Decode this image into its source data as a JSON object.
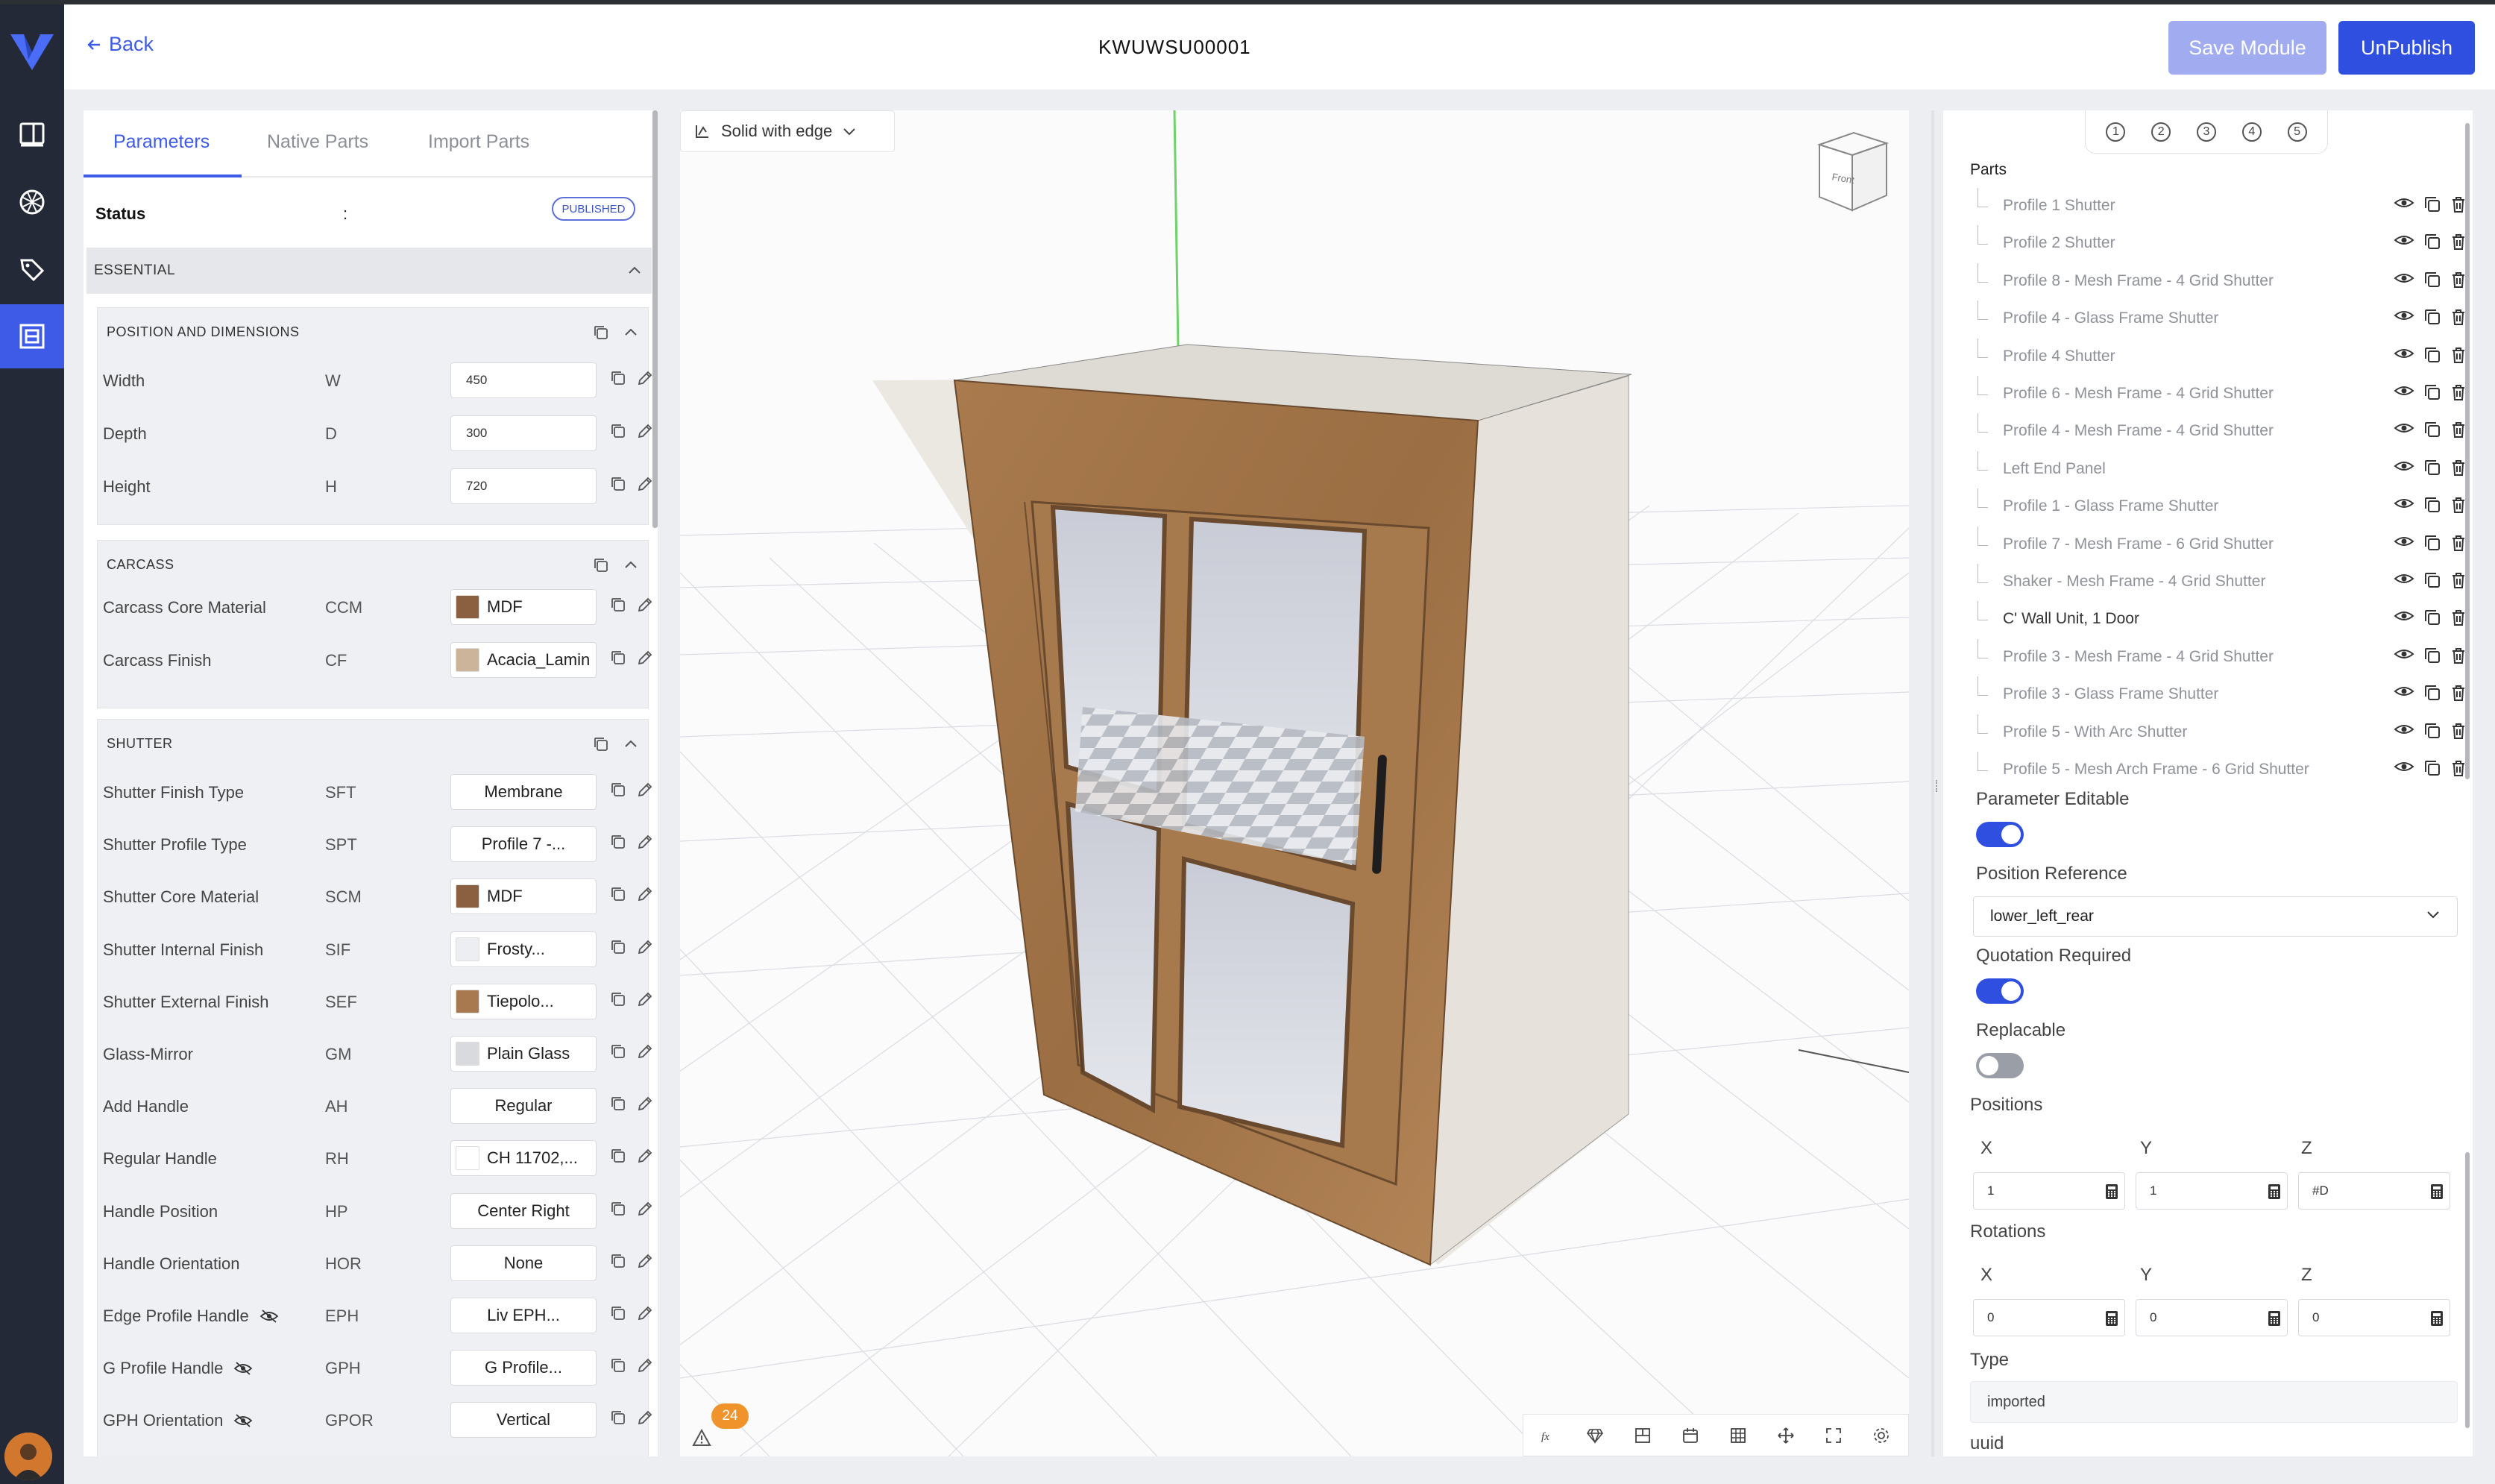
{
  "header": {
    "back_label": "Back",
    "title": "KWUWSU00001",
    "save_label": "Save Module",
    "unpublish_label": "UnPublish"
  },
  "nav": {
    "items": [
      "catalog-icon",
      "materials-icon",
      "tags-icon",
      "modules-icon"
    ],
    "active": "modules-icon"
  },
  "left_panel": {
    "tabs": [
      {
        "label": "Parameters",
        "active": true
      },
      {
        "label": "Native Parts",
        "active": false
      },
      {
        "label": "Import Parts",
        "active": false
      }
    ],
    "status": {
      "label": "Status",
      "separator": ":",
      "value": "PUBLISHED"
    },
    "sections": {
      "essential": "ESSENTIAL",
      "position": "POSITION AND DIMENSIONS",
      "carcass": "CARCASS",
      "shutter": "SHUTTER"
    },
    "position_params": [
      {
        "name": "Width",
        "code": "W",
        "value": "450"
      },
      {
        "name": "Depth",
        "code": "D",
        "value": "300"
      },
      {
        "name": "Height",
        "code": "H",
        "value": "720"
      }
    ],
    "carcass_params": [
      {
        "name": "Carcass Core Material",
        "code": "CCM",
        "value": "MDF",
        "swatch": "#8a6040"
      },
      {
        "name": "Carcass Finish",
        "code": "CF",
        "value": "Acacia_Lamin",
        "swatch": "#cbb49a"
      }
    ],
    "shutter_params": [
      {
        "name": "Shutter Finish Type",
        "code": "SFT",
        "value": "Membrane"
      },
      {
        "name": "Shutter Profile Type",
        "code": "SPT",
        "value": "Profile 7 -..."
      },
      {
        "name": "Shutter Core Material",
        "code": "SCM",
        "value": "MDF",
        "swatch": "#8a6040"
      },
      {
        "name": "Shutter Internal Finish",
        "code": "SIF",
        "value": "Frosty...",
        "swatch": "#eceef1"
      },
      {
        "name": "Shutter External Finish",
        "code": "SEF",
        "value": "Tiepolo...",
        "swatch": "#a8784f"
      },
      {
        "name": "Glass-Mirror",
        "code": "GM",
        "value": "Plain Glass",
        "swatch": "#d9dadd"
      },
      {
        "name": "Add Handle",
        "code": "AH",
        "value": "Regular"
      },
      {
        "name": "Regular Handle",
        "code": "RH",
        "value": "CH 11702,...",
        "swatch": "#ffffff"
      },
      {
        "name": "Handle Position",
        "code": "HP",
        "value": "Center Right"
      },
      {
        "name": "Handle Orientation",
        "code": "HOR",
        "value": "None"
      },
      {
        "name": "Edge Profile Handle",
        "code": "EPH",
        "value": "Liv EPH...",
        "hidden_icon": true
      },
      {
        "name": "G Profile Handle",
        "code": "GPH",
        "value": "G Profile...",
        "hidden_icon": true
      },
      {
        "name": "GPH Orientation",
        "code": "GPOR",
        "value": "Vertical",
        "hidden_icon": true
      }
    ]
  },
  "viewport": {
    "view_mode": "Solid with edge",
    "view_cube_label": "Front",
    "warnings_count": "24",
    "toolbar_icons": [
      "formula-icon",
      "material-icon",
      "section-icon",
      "calendar-icon",
      "grid-icon",
      "move-icon",
      "fullscreen-icon",
      "settings-icon"
    ]
  },
  "right_panel": {
    "steps": [
      "①",
      "②",
      "③",
      "④",
      "⑤"
    ],
    "parts_title": "Parts",
    "parts": [
      {
        "name": "Profile 1 Shutter",
        "dark": false
      },
      {
        "name": "Profile 2 Shutter",
        "dark": false
      },
      {
        "name": "Profile 8 - Mesh Frame - 4 Grid Shutter",
        "dark": false
      },
      {
        "name": "Profile 4 - Glass Frame Shutter",
        "dark": false
      },
      {
        "name": "Profile 4 Shutter",
        "dark": false
      },
      {
        "name": "Profile 6 - Mesh Frame - 4 Grid Shutter",
        "dark": false
      },
      {
        "name": "Profile 4 - Mesh Frame - 4 Grid Shutter",
        "dark": false
      },
      {
        "name": "Left End Panel",
        "dark": false
      },
      {
        "name": "Profile 1 - Glass Frame Shutter",
        "dark": false
      },
      {
        "name": "Profile 7 - Mesh Frame - 6 Grid Shutter",
        "dark": false
      },
      {
        "name": "Shaker - Mesh Frame - 4 Grid Shutter",
        "dark": false
      },
      {
        "name": "C' Wall Unit, 1 Door",
        "dark": true
      },
      {
        "name": "Profile 3 - Mesh Frame - 4 Grid Shutter",
        "dark": false
      },
      {
        "name": "Profile 3 - Glass Frame Shutter",
        "dark": false
      },
      {
        "name": "Profile 5 - With Arc Shutter",
        "dark": false
      },
      {
        "name": "Profile 5 - Mesh Arch Frame - 6 Grid Shutter",
        "dark": false
      }
    ],
    "props": {
      "param_editable_label": "Parameter Editable",
      "param_editable": true,
      "position_ref_label": "Position Reference",
      "position_ref": "lower_left_rear",
      "quotation_label": "Quotation Required",
      "quotation": true,
      "replacable_label": "Replacable",
      "replacable": false,
      "positions_label": "Positions",
      "positions": {
        "x": "1",
        "y": "1",
        "z": "#D"
      },
      "rotations_label": "Rotations",
      "rotations": {
        "x": "0",
        "y": "0",
        "z": "0"
      },
      "axis": {
        "x": "X",
        "y": "Y",
        "z": "Z"
      },
      "type_label": "Type",
      "type_value": "imported",
      "uuid_label": "uuid"
    }
  },
  "colors": {
    "accent": "#2f4fe0",
    "nav_bg": "#242938",
    "save_disabled": "#a1acf0",
    "warning": "#f0932b"
  }
}
